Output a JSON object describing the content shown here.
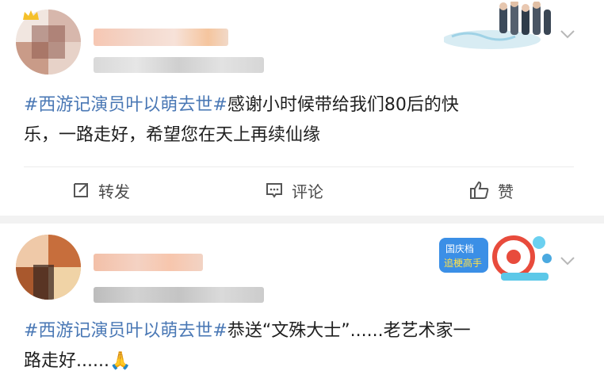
{
  "posts": [
    {
      "hashtag": "#西游记演员叶以萌去世#",
      "text_line1": "感谢小时候带给我们80后的快",
      "text_line2": "乐，一路走好，希望您在天上再续仙缘",
      "actions": {
        "repost": "转发",
        "comment": "评论",
        "like": "赞"
      }
    },
    {
      "hashtag": "#西游记演员叶以萌去世#",
      "text_line1": "恭送“文殊大士”......老艺术家一",
      "text_line2": "路走好......",
      "emoji": "🙏",
      "badge_text_1": "国庆档",
      "badge_text_2": "追梗高手"
    }
  ],
  "colors": {
    "hashtag": "#4a78b5",
    "text": "#1f1f1f",
    "separator": "#f2f2f2",
    "action_text": "#4a4a4a"
  },
  "icons": [
    "chevron-down-icon",
    "repost-icon",
    "comment-icon",
    "like-icon",
    "crown-icon",
    "praying-hands-emoji"
  ]
}
